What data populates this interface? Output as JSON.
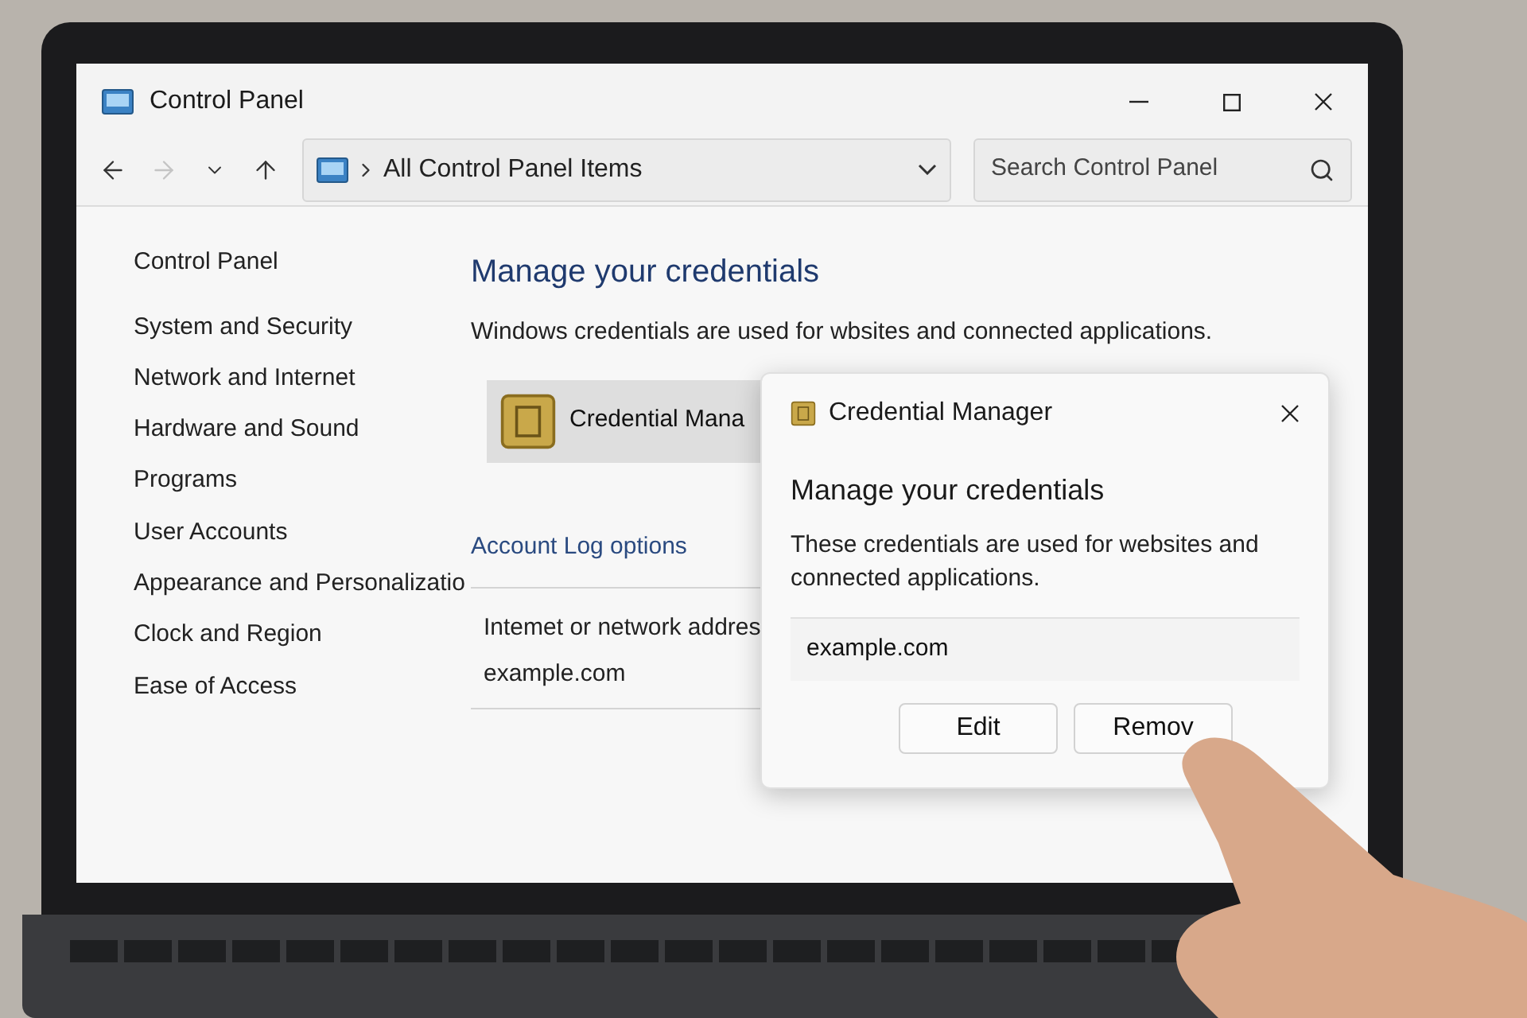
{
  "window": {
    "title": "Control Panel"
  },
  "nav_buttons": [
    {
      "kind": "back",
      "disabled": false
    },
    {
      "kind": "forward",
      "disabled": true
    },
    {
      "kind": "recent",
      "disabled": false
    },
    {
      "kind": "up",
      "disabled": false
    }
  ],
  "address": {
    "path": "All Control Panel Items"
  },
  "search": {
    "placeholder": "Search Control Panel"
  },
  "sidebar": {
    "title": "Control Panel",
    "items": [
      "System and Security",
      "Network and Internet",
      "Hardware and Sound",
      "Programs",
      "User Accounts",
      "Appearance and Personalizatio",
      "Clock and Region",
      "Ease of Access"
    ]
  },
  "main": {
    "heading": "Manage your credentials",
    "description": "Windows credentials are used for wbsites and connected applications.",
    "tile": {
      "label": "Credential Mana"
    },
    "link": "Account Log options",
    "table": {
      "column_1": "Intemet or network addres",
      "rows": [
        "example.com"
      ]
    }
  },
  "dialog": {
    "title": "Credential Manager",
    "heading": "Manage your credentials",
    "description": "These credentials are used for websites and connected applications.",
    "entry": "example.com",
    "buttons": [
      "Edit",
      "Remov"
    ]
  }
}
